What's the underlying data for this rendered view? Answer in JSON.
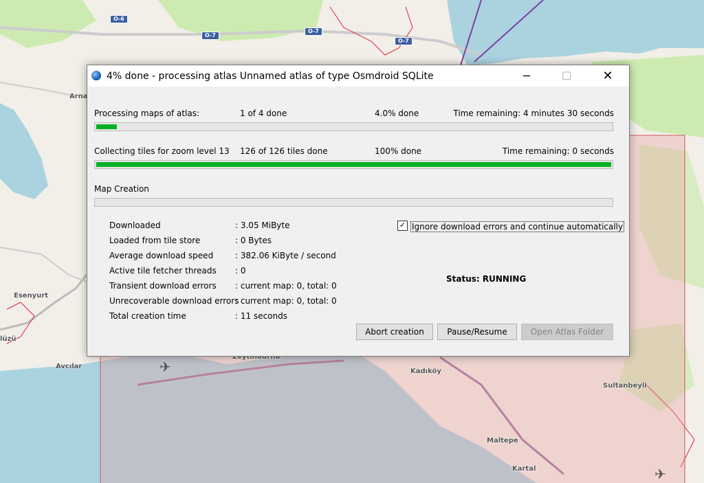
{
  "window": {
    "title": "4% done - processing atlas Unnamed atlas of type Osmdroid SQLite",
    "min_glyph": "─",
    "max_glyph": "☐",
    "close_glyph": "✕"
  },
  "progress": {
    "maps": {
      "label": "Processing maps of atlas:",
      "count": "1 of 4 done",
      "percent": "4.0% done",
      "remaining": "Time remaining: 4 minutes 30 seconds",
      "fraction": 0.04
    },
    "tiles": {
      "label": "Collecting tiles for zoom level 13",
      "count": "126 of 126 tiles done",
      "percent": "100% done",
      "remaining": "Time remaining: 0 seconds",
      "fraction": 1.0
    },
    "creation": {
      "label": "Map Creation",
      "fraction": 0.0
    }
  },
  "stats": [
    {
      "key": "Downloaded",
      "value": ": 3.05 MiByte"
    },
    {
      "key": "Loaded from tile store",
      "value": ": 0 Bytes"
    },
    {
      "key": "Average download speed",
      "value": ": 382.06 KiByte / second"
    },
    {
      "key": "Active tile fetcher threads",
      "value": ": 0"
    },
    {
      "key": "Transient download errors",
      "value": ": current map: 0, total: 0"
    },
    {
      "key": "Unrecoverable download errors",
      "value": ": current map: 0, total: 0"
    },
    {
      "key": "Total creation time",
      "value": ": 11 seconds"
    }
  ],
  "ignore_errors": {
    "label": "Ignore download errors and continue automatically",
    "checked": true
  },
  "status_text": "Status: RUNNING",
  "buttons": {
    "abort": "Abort creation",
    "pause": "Pause/Resume",
    "open_folder": "Open Atlas Folder"
  },
  "map": {
    "place_labels": [
      "Arna",
      "Esenyurt",
      "Avcılar",
      "Zeytinburnu",
      "Kadıköy",
      "Sultanbeyli",
      "Maltepe",
      "Kartal",
      "lüzü"
    ],
    "road_shields": [
      "O-6",
      "O-7",
      "O-7",
      "O-7"
    ],
    "colors": {
      "sea": "#aad3df",
      "land": "#f2efe9",
      "park": "#cdebb0",
      "selection": "#e8a0a0",
      "progress_fill": "#06b025"
    }
  }
}
